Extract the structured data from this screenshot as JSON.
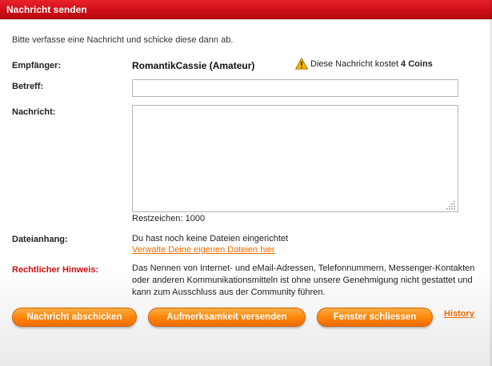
{
  "window": {
    "title": "Nachricht senden"
  },
  "intro": "Bitte verfasse eine Nachricht und schicke diese dann ab.",
  "recipient": {
    "label": "Empfänger:",
    "name": "RomantikCassie (Amateur)",
    "cost_text": "Diese Nachricht kostet",
    "cost_amount": "4 Coins",
    "warning_icon": "warning-icon"
  },
  "subject": {
    "label": "Betreff:",
    "value": ""
  },
  "message": {
    "label": "Nachricht:",
    "value": "",
    "remaining_label": "Restzeichen:",
    "remaining_count": "1000"
  },
  "attachment": {
    "label": "Dateianhang:",
    "status": "Du hast noch keine Dateien eingerichtet",
    "manage_link": "Verwalte Deine eigenen Dateien hier"
  },
  "legal": {
    "label": "Rechtlicher Hinweis:",
    "text": "Das Nennen von Internet- und eMail-Adressen, Telefonnummern, Messenger-Kontakten oder anderen Kommunikationsmitteln ist ohne unsere Genehmigung nicht gestattet und kann zum Ausschluss aus der Community führen."
  },
  "buttons": {
    "send": "Nachricht abschicken",
    "attention": "Aufmerksamkeit versenden",
    "close": "Fenster schliessen",
    "history": "History"
  },
  "colors": {
    "titlebar": "#cf0f18",
    "accent_orange": "#ff8a0e",
    "link_orange": "#ef6b00",
    "legal_red": "#cc1111"
  }
}
